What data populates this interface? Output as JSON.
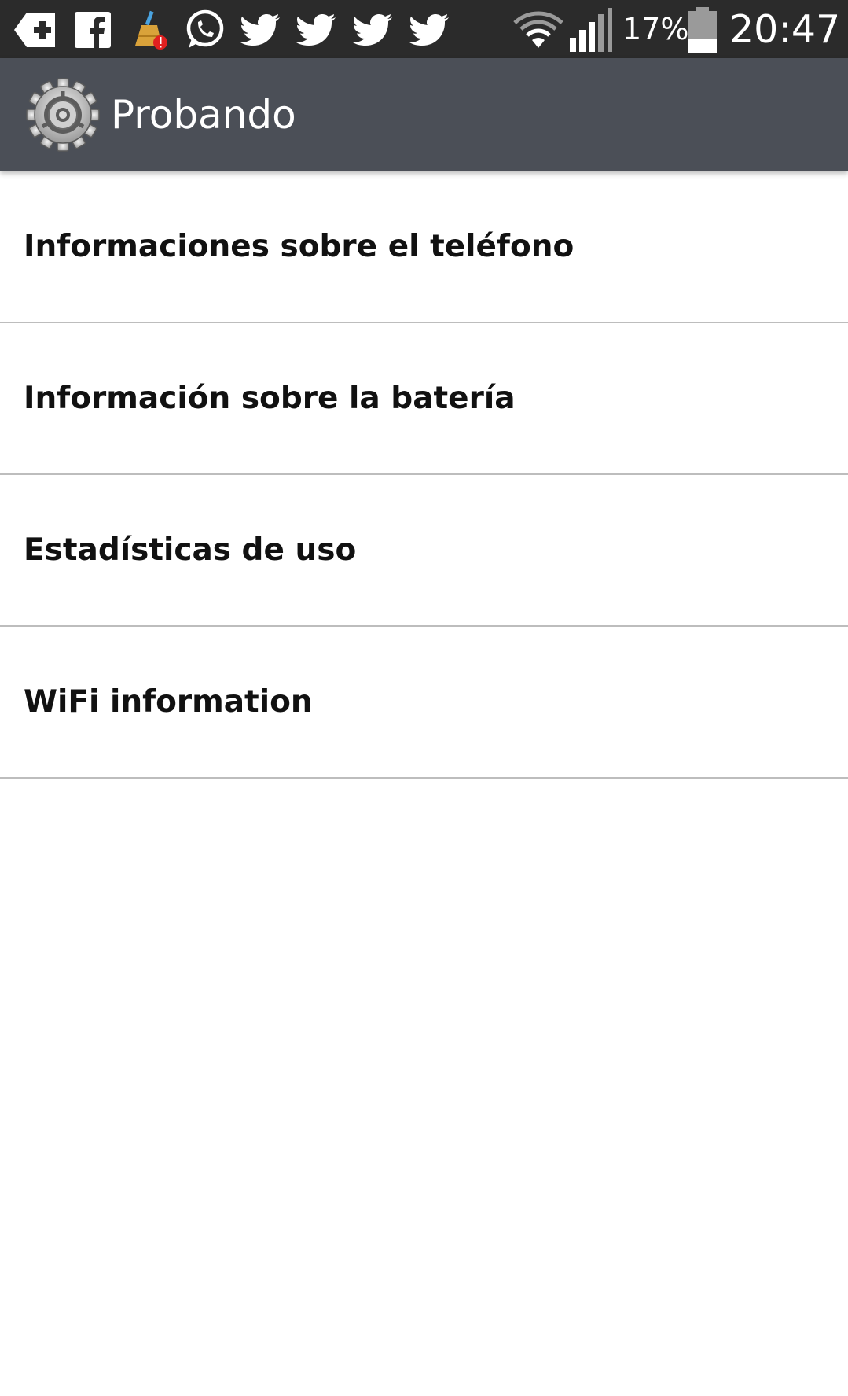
{
  "status_bar": {
    "notification_icons": [
      "add-box-icon",
      "facebook-icon",
      "cleaner-broom-alert-icon",
      "whatsapp-icon",
      "twitter-icon",
      "twitter-icon",
      "twitter-icon",
      "twitter-icon"
    ],
    "wifi_icon": "wifi-icon",
    "signal_icon": "cell-signal-icon",
    "battery_percent": "17%",
    "battery_icon": "battery-low-icon",
    "time": "20:47"
  },
  "app_bar": {
    "icon": "gear-icon",
    "title": "Probando"
  },
  "menu": {
    "items": [
      {
        "label": "Informaciones sobre el teléfono"
      },
      {
        "label": "Información sobre la batería"
      },
      {
        "label": "Estadísticas de uso"
      },
      {
        "label": "WiFi information"
      }
    ]
  },
  "colors": {
    "status_bar_bg": "#2b2b2b",
    "app_bar_bg": "#4b4f57",
    "list_bg": "#ffffff",
    "divider": "#bdbdbd",
    "item_text": "#111111"
  }
}
